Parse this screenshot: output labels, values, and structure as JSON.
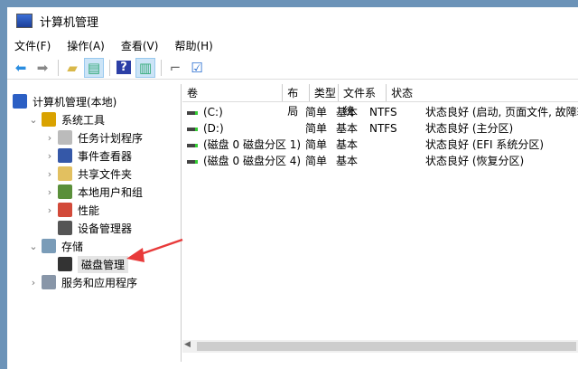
{
  "window": {
    "title": "计算机管理"
  },
  "menu": [
    "文件(F)",
    "操作(A)",
    "查看(V)",
    "帮助(H)"
  ],
  "toolbar": [
    "back-icon",
    "forward-icon",
    "up-folder-icon",
    "show-hide-tree-icon",
    "help-icon",
    "show-hide-action-pane-icon",
    "connect-icon",
    "properties-icon"
  ],
  "tree": [
    {
      "label": "计算机管理(本地)",
      "level": 0,
      "chevron": "",
      "icon": "computer-icon",
      "color": "#2b5fc4"
    },
    {
      "label": "系统工具",
      "level": 1,
      "chevron": "⌄",
      "icon": "tools-icon",
      "color": "#d9a200"
    },
    {
      "label": "任务计划程序",
      "level": 2,
      "chevron": "›",
      "icon": "clock-icon",
      "color": "#bbb"
    },
    {
      "label": "事件查看器",
      "level": 2,
      "chevron": "›",
      "icon": "event-viewer-icon",
      "color": "#3558a8"
    },
    {
      "label": "共享文件夹",
      "level": 2,
      "chevron": "›",
      "icon": "shared-folder-icon",
      "color": "#e2c060"
    },
    {
      "label": "本地用户和组",
      "level": 2,
      "chevron": "›",
      "icon": "users-icon",
      "color": "#5a8f3a"
    },
    {
      "label": "性能",
      "level": 2,
      "chevron": "›",
      "icon": "performance-icon",
      "color": "#d24a3a"
    },
    {
      "label": "设备管理器",
      "level": 2,
      "chevron": "",
      "icon": "device-manager-icon",
      "color": "#555"
    },
    {
      "label": "存储",
      "level": 1,
      "chevron": "⌄",
      "icon": "storage-icon",
      "color": "#7a9cb8"
    },
    {
      "label": "磁盘管理",
      "level": 2,
      "chevron": "",
      "icon": "disk-icon",
      "color": "#333",
      "selected": true
    },
    {
      "label": "服务和应用程序",
      "level": 1,
      "chevron": "›",
      "icon": "services-icon",
      "color": "#8896a8"
    }
  ],
  "columns": [
    "卷",
    "布局",
    "类型",
    "文件系统",
    "状态"
  ],
  "rows": [
    [
      "(C:)",
      "简单",
      "基本",
      "NTFS",
      "状态良好 (启动, 页面文件, 故障转"
    ],
    [
      "(D:)",
      "简单",
      "基本",
      "NTFS",
      "状态良好 (主分区)"
    ],
    [
      "(磁盘 0 磁盘分区 1)",
      "简单",
      "基本",
      "",
      "状态良好 (EFI 系统分区)"
    ],
    [
      "(磁盘 0 磁盘分区 4)",
      "简单",
      "基本",
      "",
      "状态良好 (恢复分区)"
    ]
  ]
}
